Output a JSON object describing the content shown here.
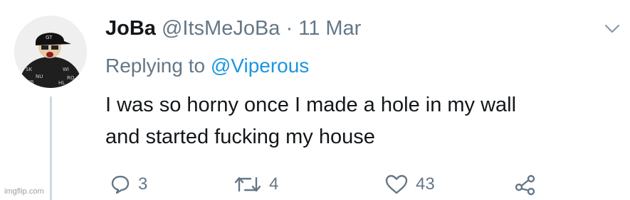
{
  "tweet": {
    "display_name": "JoBa",
    "handle": "@ItsMeJoBa",
    "separator": "·",
    "date": "11 Mar",
    "replying_prefix": "Replying to",
    "replying_to": "@Viperous",
    "text_line1": "I was so horny once I made a hole in my wall",
    "text_line2": "and started fucking my house"
  },
  "actions": {
    "reply_count": "3",
    "retweet_count": "4",
    "like_count": "43"
  },
  "icons": {
    "reply": "speech-bubble-icon",
    "retweet": "retweet-arrows-icon",
    "like": "heart-icon",
    "share": "share-nodes-icon",
    "more": "chevron-down-icon"
  },
  "colors": {
    "text": "#14171a",
    "secondary": "#657786",
    "link": "#1b95e0",
    "thread_line": "#cfd9de"
  },
  "watermark": "imgflip.com"
}
